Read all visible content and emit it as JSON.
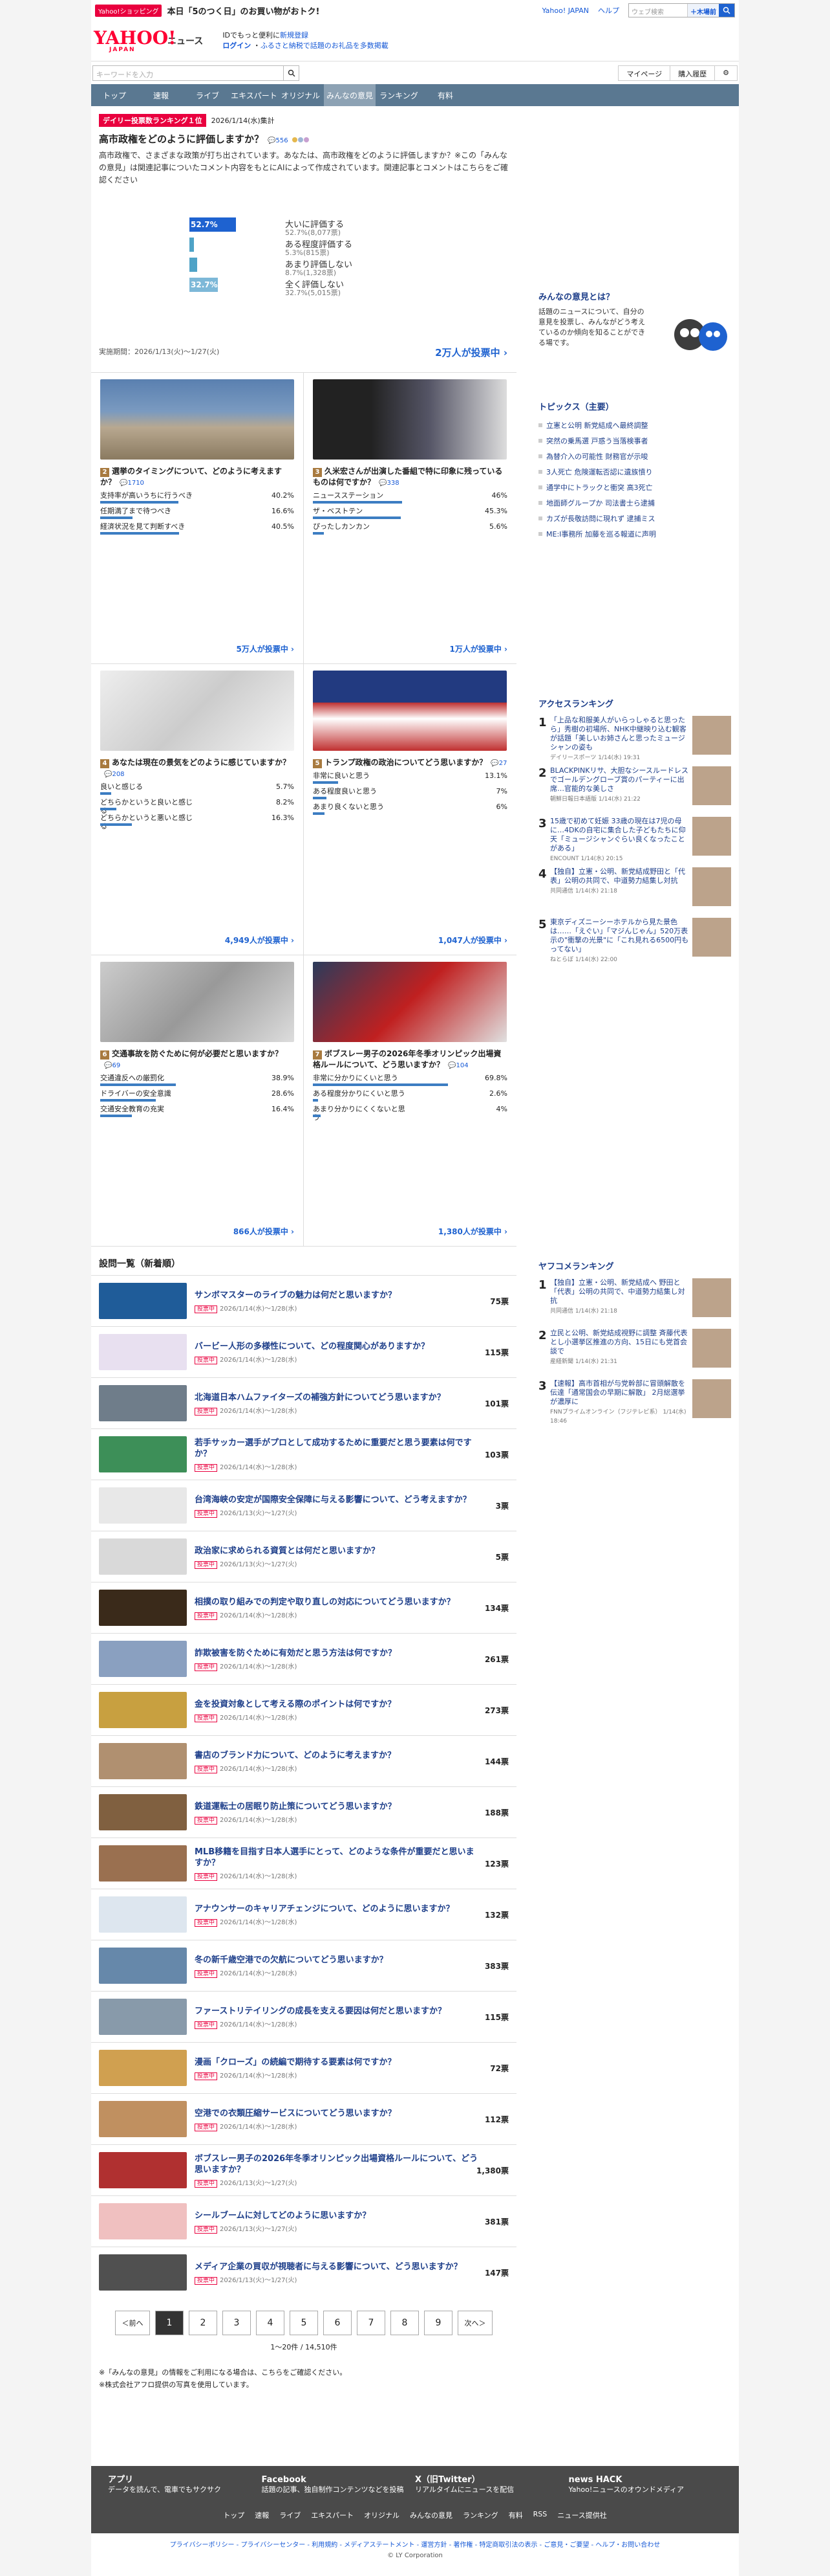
{
  "promo": {
    "tag": "Yahoo!ショッピング",
    "text": "本日「5のつく日」のお買い物がおトク!",
    "links": [
      "Yahoo! JAPAN",
      "ヘルプ"
    ],
    "search_placeholder": "ウェブ検索",
    "search_btn": "＋木場前"
  },
  "header": {
    "news": "ニュース",
    "idtext": "IDでもっと便利に",
    "newreg": "新規登録",
    "login": "ログイン",
    "furusato": "ふるさと納税で話題のお礼品を多数掲載"
  },
  "search": {
    "placeholder": "キーワードを入力",
    "mypage": "マイページ",
    "history": "購入履歴"
  },
  "nav": [
    "トップ",
    "速報",
    "ライブ",
    "エキスパート",
    "オリジナル",
    "みんなの意見",
    "ランキング",
    "有料"
  ],
  "feature": {
    "rank_label": "デイリー投票数ランキング１位",
    "date": "2026/1/14(水)集計",
    "question": "高市政権をどのように評価しますか？",
    "comments": "556",
    "desc": "高市政権で、さまざまな政策が打ち出されています。あなたは、高市政権をどのように評価しますか？※この「みんなの意見」は関連記事についたコメント内容をもとにAIによって作成されています。関連記事とコメントはこちらをご確認ください",
    "options": [
      {
        "label": "大いに評価する",
        "pct": "52.7%",
        "count": "(8,077票)",
        "value": 52.7
      },
      {
        "label": "ある程度評価する",
        "pct": "5.3%",
        "count": "(815票)",
        "value": 5.3
      },
      {
        "label": "あまり評価しない",
        "pct": "8.7%",
        "count": "(1,328票)",
        "value": 8.7
      },
      {
        "label": "全く評価しない",
        "pct": "32.7%",
        "count": "(5,015票)",
        "value": 32.7
      }
    ],
    "period": "実施期間：2026/1/13(火)〜1/27(火)",
    "vote": "2万人が投票中"
  },
  "polls": [
    {
      "num": "2",
      "q": "選挙のタイミングについて、どのように考えますか？",
      "c": "1710",
      "opts": [
        {
          "l": "支持率が高いうちに行うべき",
          "p": "40.2%",
          "v": 40.2
        },
        {
          "l": "任期満了まで待つべき",
          "p": "16.6%",
          "v": 16.6
        },
        {
          "l": "経済状況を見て判断すべき",
          "p": "40.5%",
          "v": 40.5
        }
      ],
      "vote": "5万人が投票中"
    },
    {
      "num": "3",
      "q": "久米宏さんが出演した番組で特に印象に残っているものは何ですか？",
      "c": "338",
      "opts": [
        {
          "l": "ニュースステーション",
          "p": "46%",
          "v": 46
        },
        {
          "l": "ザ・ベストテン",
          "p": "45.3%",
          "v": 45.3
        },
        {
          "l": "ぴったしカンカン",
          "p": "5.6%",
          "v": 5.6
        }
      ],
      "vote": "1万人が投票中"
    },
    {
      "num": "4",
      "q": "あなたは現在の景気をどのように感じていますか？",
      "c": "208",
      "opts": [
        {
          "l": "良いと感じる",
          "p": "5.7%",
          "v": 5.7
        },
        {
          "l": "どちらかというと良いと感じる",
          "p": "8.2%",
          "v": 8.2
        },
        {
          "l": "どちらかというと悪いと感じる",
          "p": "16.3%",
          "v": 16.3
        }
      ],
      "vote": "4,949人が投票中"
    },
    {
      "num": "5",
      "q": "トランプ政権の政治についてどう思いますか？",
      "c": "27",
      "opts": [
        {
          "l": "非常に良いと思う",
          "p": "13.1%",
          "v": 13.1
        },
        {
          "l": "ある程度良いと思う",
          "p": "7%",
          "v": 7
        },
        {
          "l": "あまり良くないと思う",
          "p": "6%",
          "v": 6
        }
      ],
      "vote": "1,047人が投票中"
    },
    {
      "num": "6",
      "q": "交通事故を防ぐために何が必要だと思いますか？",
      "c": "69",
      "opts": [
        {
          "l": "交通違反への厳罰化",
          "p": "38.9%",
          "v": 38.9
        },
        {
          "l": "ドライバーの安全意識",
          "p": "28.6%",
          "v": 28.6
        },
        {
          "l": "交通安全教育の充実",
          "p": "16.4%",
          "v": 16.4
        }
      ],
      "vote": "866人が投票中"
    },
    {
      "num": "7",
      "q": "ボブスレー男子の2026年冬季オリンピック出場資格ルールについて、どう思いますか？",
      "c": "104",
      "opts": [
        {
          "l": "非常に分かりにくいと思う",
          "p": "69.8%",
          "v": 69.8
        },
        {
          "l": "ある程度分かりにくいと思う",
          "p": "2.6%",
          "v": 2.6
        },
        {
          "l": "あまり分かりにくくないと思う",
          "p": "4%",
          "v": 4
        }
      ],
      "vote": "1,380人が投票中"
    }
  ],
  "list_title": "設問一覧（新着順）",
  "list": [
    {
      "t": "サンボマスターのライブの魅力は何だと思いますか？",
      "m": "2026/1/14(水)〜1/28(水)",
      "v": "75票",
      "c": "#1f5c99"
    },
    {
      "t": "バービー人形の多様性について、どの程度関心がありますか？",
      "m": "2026/1/14(水)〜1/28(水)",
      "v": "115票",
      "c": "#e8e0f0"
    },
    {
      "t": "北海道日本ハムファイターズの補強方針についてどう思いますか？",
      "m": "2026/1/14(水)〜1/28(水)",
      "v": "101票",
      "c": "#6f7d8a"
    },
    {
      "t": "若手サッカー選手がプロとして成功するために重要だと思う要素は何ですか？",
      "m": "2026/1/14(水)〜1/28(水)",
      "v": "103票",
      "c": "#3d8f58"
    },
    {
      "t": "台湾海峡の安定が国際安全保障に与える影響について、どう考えますか？",
      "m": "2026/1/13(火)〜1/27(火)",
      "v": "3票",
      "c": "#e8e8e8"
    },
    {
      "t": "政治家に求められる資質とは何だと思いますか？",
      "m": "2026/1/13(火)〜1/27(火)",
      "v": "5票",
      "c": "#d9d9d9"
    },
    {
      "t": "相撲の取り組みでの判定や取り直しの対応についてどう思いますか？",
      "m": "2026/1/14(水)〜1/28(水)",
      "v": "134票",
      "c": "#3a2a1a"
    },
    {
      "t": "詐欺被害を防ぐために有効だと思う方法は何ですか？",
      "m": "2026/1/14(水)〜1/28(水)",
      "v": "261票",
      "c": "#8aa0c0"
    },
    {
      "t": "金を投資対象として考える際のポイントは何ですか？",
      "m": "2026/1/14(水)〜1/28(水)",
      "v": "273票",
      "c": "#c8a040"
    },
    {
      "t": "書店のブランド力について、どのように考えますか？",
      "m": "2026/1/14(水)〜1/28(水)",
      "v": "144票",
      "c": "#b09070"
    },
    {
      "t": "鉄道運転士の居眠り防止策についてどう思いますか？",
      "m": "2026/1/14(水)〜1/28(水)",
      "v": "188票",
      "c": "#806040"
    },
    {
      "t": "MLB移籍を目指す日本人選手にとって、どのような条件が重要だと思いますか？",
      "m": "2026/1/14(水)〜1/28(水)",
      "v": "123票",
      "c": "#9a7050"
    },
    {
      "t": "アナウンサーのキャリアチェンジについて、どのように思いますか？",
      "m": "2026/1/14(水)〜1/28(水)",
      "v": "132票",
      "c": "#dde6ef"
    },
    {
      "t": "冬の新千歳空港での欠航についてどう思いますか？",
      "m": "2026/1/14(水)〜1/28(水)",
      "v": "383票",
      "c": "#6688aa"
    },
    {
      "t": "ファーストリテイリングの成長を支える要因は何だと思いますか？",
      "m": "2026/1/14(水)〜1/28(水)",
      "v": "115票",
      "c": "#889aaa"
    },
    {
      "t": "漫画「クローズ」の続編で期待する要素は何ですか？",
      "m": "2026/1/14(水)〜1/28(水)",
      "v": "72票",
      "c": "#d0a050"
    },
    {
      "t": "空港での衣類圧縮サービスについてどう思いますか？",
      "m": "2026/1/14(水)〜1/28(水)",
      "v": "112票",
      "c": "#c09060"
    },
    {
      "t": "ボブスレー男子の2026年冬季オリンピック出場資格ルールについて、どう思いますか？",
      "m": "2026/1/13(火)〜1/27(火)",
      "v": "1,380票",
      "c": "#b03030"
    },
    {
      "t": "シールブームに対してどのように思いますか？",
      "m": "2026/1/13(火)〜1/27(火)",
      "v": "381票",
      "c": "#f0c0c0"
    },
    {
      "t": "メディア企業の買収が視聴者に与える影響について、どう思いますか？",
      "m": "2026/1/13(火)〜1/27(火)",
      "v": "147票",
      "c": "#505050"
    }
  ],
  "pager": {
    "prev": "＜前へ",
    "pages": [
      "1",
      "2",
      "3",
      "4",
      "5",
      "6",
      "7",
      "8",
      "9"
    ],
    "next": "次へ＞",
    "count": "1〜20件 / 14,510件"
  },
  "notes": [
    "※「みんなの意見」の情報をご利用になる場合は、こちらをご確認ください。",
    "※株式会社アフロ提供の写真を使用しています。"
  ],
  "side": {
    "opinion_title": "みんなの意見とは？",
    "opinion_text": "話題のニュースについて、自分の意見を投票し、みんながどう考えているのか傾向を知ることができる場です。",
    "topics_title": "トピックス（主要）",
    "topics": [
      "立憲と公明 新党結成へ最終調整",
      "突然の乗馬選 戸惑う当落検事者",
      "為替介入の可能性 財務官が示唆",
      "3人死亡 危険運転否認に遺族憤り",
      "通学中にトラックと衝突 高3死亡",
      "地面師グループか 司法書士ら逮捕",
      "カズが長敬訪問に現れず 逮捕ミス",
      "ME:I事務所 加藤を巡る報道に声明"
    ],
    "access_title": "アクセスランキング",
    "access": [
      {
        "t": "「上品な和服美人がいらっしゃると思ったら」秀樹の初場所、NHK中継映り込む観客が話題「美しいお姉さんと思ったミュージシャンの姿も",
        "s": "デイリースポーツ 1/14(水) 19:31"
      },
      {
        "t": "BLACKPINKリサ、大胆なシースルードレスでゴールデングローブ賞のパーティーに出席…官能的な美しさ",
        "s": "朝鮮日報日本語版 1/14(水) 21:22"
      },
      {
        "t": "15歳で初めて妊娠 33歳の現在は7児の母に…4DKの自宅に集合した子どもたちに仰天「ミュージシャンぐらい良くなったことがある」",
        "s": "ENCOUNT 1/14(水) 20:15"
      },
      {
        "t": "【独自】立憲・公明、新党結成野田と「代表」公明の共同で、中道勢力結集し対抗",
        "s": "共同通信 1/14(水) 21:18"
      },
      {
        "t": "東京ディズニーシーホテルから見た景色は……「えぐい」「マジんじゃん」520万表示の\"衝撃の光景\"に「これ見れる6500円もってない」",
        "s": "ねとらぼ 1/14(水) 22:00"
      }
    ],
    "yafoo_title": "ヤフコメランキング",
    "yafoo": [
      {
        "t": "【独自】立憲・公明、新党結成へ 野田と「代表」公明の共同で、中道勢力結集し対抗",
        "s": "共同通信 1/14(水) 21:18"
      },
      {
        "t": "立民と公明、新党結成視野に調整 斉藤代表とし小選挙区推進の方向、15日にも党首会談で",
        "s": "産経新聞 1/14(水) 21:31"
      },
      {
        "t": "【速報】高市首相が与党幹部に冒頭解散を伝達「通常国会の早期に解散」 2月総選挙が濃厚に",
        "s": "FNNプライムオンライン（フジテレビ系） 1/14(水) 18:46"
      }
    ]
  },
  "footer": {
    "cols": [
      {
        "h": "アプリ",
        "s": "データを読んで、電車でもサクサク"
      },
      {
        "h": "Facebook",
        "s": "話題の記事、独自制作コンテンツなどを投稿"
      },
      {
        "h": "X（旧Twitter）",
        "s": "リアルタイムにニュースを配信"
      },
      {
        "h": "news HACK",
        "s": "Yahoo!ニュースのオウンドメディア"
      }
    ],
    "links": [
      "トップ",
      "速報",
      "ライブ",
      "エキスパート",
      "オリジナル",
      "みんなの意見",
      "ランキング",
      "有料",
      "RSS",
      "ニュース提供社"
    ],
    "legal": "プライバシーポリシー - プライバシーセンター - 利用規約 - メディアステートメント - 運営方針 - 著作権 - 特定商取引法の表示 - ご意見・ご要望 - ヘルプ・お問い合わせ",
    "copy": "© LY Corporation"
  }
}
